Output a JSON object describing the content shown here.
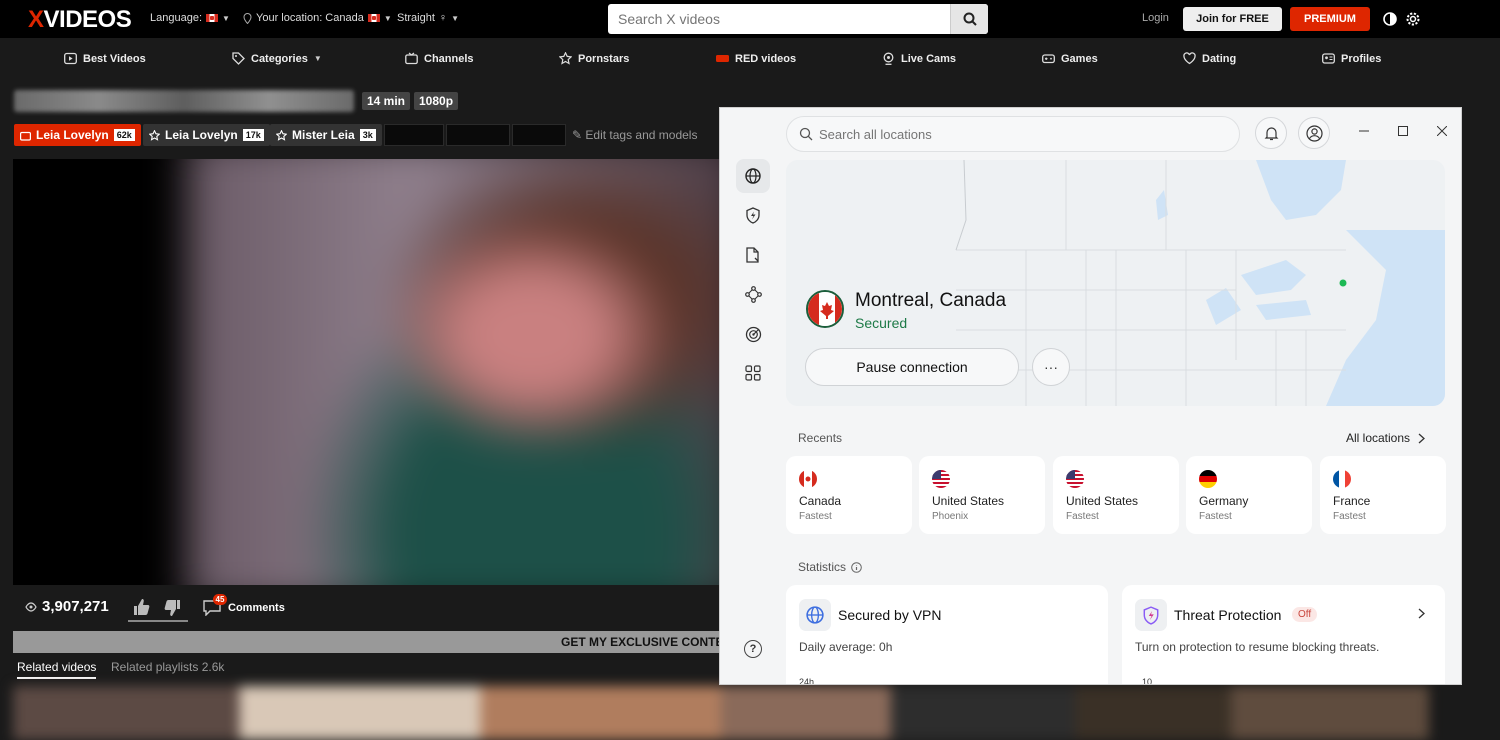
{
  "site": {
    "logo_x": "X",
    "logo_rest": "VIDEOS",
    "language_label": "Language:",
    "location_label": "Your location: Canada",
    "orientation_label": "Straight",
    "search_placeholder": "Search X videos",
    "login": "Login",
    "join": "Join for FREE",
    "premium": "PREMIUM"
  },
  "nav": {
    "items": [
      {
        "label": "Best Videos",
        "icon": "play-square-icon"
      },
      {
        "label": "Categories",
        "icon": "tag-icon"
      },
      {
        "label": "Channels",
        "icon": "tv-icon"
      },
      {
        "label": "Pornstars",
        "icon": "star-icon"
      },
      {
        "label": "RED videos",
        "icon": "red-badge-icon"
      },
      {
        "label": "Live Cams",
        "icon": "webcam-icon"
      },
      {
        "label": "Games",
        "icon": "gamepad-icon"
      },
      {
        "label": "Dating",
        "icon": "heart-icon"
      },
      {
        "label": "Profiles",
        "icon": "profiles-icon"
      }
    ]
  },
  "video": {
    "duration": "14 min",
    "quality": "1080p",
    "tags": [
      {
        "label": "Leia Lovelyn",
        "count": "62k"
      },
      {
        "label": "Leia Lovelyn",
        "count": "17k"
      },
      {
        "label": "Mister Leia",
        "count": "3k"
      }
    ],
    "edit_tags": "Edit tags and models",
    "views": "3,907,271",
    "comment_count": "45",
    "comments_label": "Comments",
    "banner": "GET MY EXCLUSIVE CONTE",
    "related_videos": "Related videos",
    "related_playlists": "Related playlists",
    "related_playlists_count": "2.6k"
  },
  "vpn": {
    "search_placeholder": "Search all locations",
    "location": "Montreal, Canada",
    "status": "Secured",
    "pause": "Pause connection",
    "more": "···",
    "recents_label": "Recents",
    "all_locations": "All locations",
    "recents": [
      {
        "name": "Canada",
        "sub": "Fastest",
        "flag": "ca"
      },
      {
        "name": "United States",
        "sub": "Phoenix",
        "flag": "us"
      },
      {
        "name": "United States",
        "sub": "Fastest",
        "flag": "us"
      },
      {
        "name": "Germany",
        "sub": "Fastest",
        "flag": "de"
      },
      {
        "name": "France",
        "sub": "Fastest",
        "flag": "fr"
      }
    ],
    "statistics_label": "Statistics",
    "stats": {
      "vpn_title": "Secured by VPN",
      "vpn_desc": "Daily average: ",
      "vpn_value": "0h",
      "vpn_axis": "24h",
      "threat_title": "Threat Protection",
      "threat_badge": "Off",
      "threat_desc": "Turn on protection to resume blocking threats.",
      "threat_axis": "10"
    },
    "colors": {
      "secured": "#1d7a47",
      "accent": "#de2600"
    }
  }
}
